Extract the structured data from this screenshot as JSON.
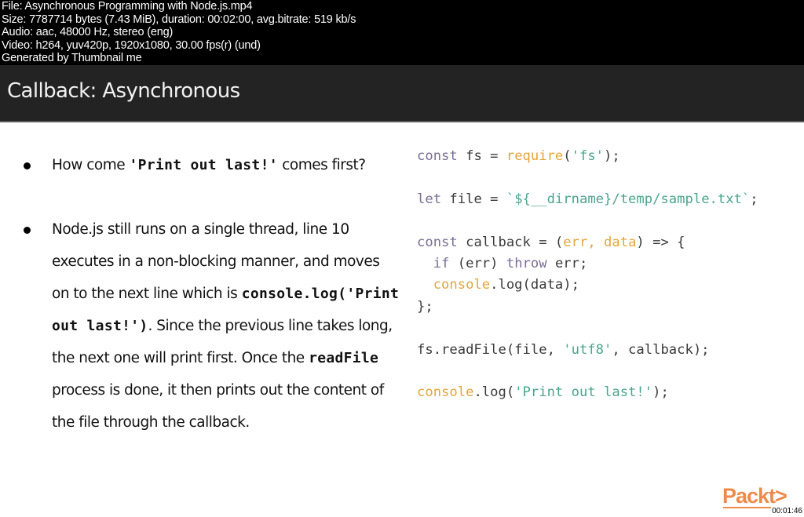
{
  "meta": {
    "lines": [
      "File: Asynchronous Programming with Node.js.mp4",
      "Size: 7787714 bytes (7.43 MiB), duration: 00:02:00, avg.bitrate: 519 kb/s",
      "Audio: aac, 48000 Hz, stereo (eng)",
      "Video: h264, yuv420p, 1920x1080, 30.00 fps(r) (und)",
      "Generated by Thumbnail me"
    ]
  },
  "slide": {
    "title": "Callback: Asynchronous",
    "bullets": [
      {
        "parts": [
          {
            "text": "How come ",
            "style": "normal"
          },
          {
            "text": "'Print out last!'",
            "style": "code"
          },
          {
            "text": " comes first?",
            "style": "normal"
          }
        ]
      },
      {
        "parts": [
          {
            "text": "Node.js still runs on a single thread, line 10 executes in a non-blocking manner, and moves on to the next line which is ",
            "style": "normal"
          },
          {
            "text": "console.log('Print out last!')",
            "style": "code"
          },
          {
            "text": ". Since the previous line takes long, the next one will print first. Once the ",
            "style": "normal"
          },
          {
            "text": "readFile",
            "style": "code"
          },
          {
            "text": " process is done, it then prints out the content of the file through the callback.",
            "style": "normal"
          }
        ]
      }
    ],
    "code_lines": [
      [
        {
          "t": "const",
          "c": "kw"
        },
        {
          "t": " fs = ",
          "c": ""
        },
        {
          "t": "require",
          "c": "fn"
        },
        {
          "t": "(",
          "c": ""
        },
        {
          "t": "'fs'",
          "c": "str"
        },
        {
          "t": ");",
          "c": ""
        }
      ],
      [],
      [
        {
          "t": "let",
          "c": "kw"
        },
        {
          "t": " file = ",
          "c": ""
        },
        {
          "t": "`${__dirname}/temp/sample.txt`",
          "c": "str"
        },
        {
          "t": ";",
          "c": ""
        }
      ],
      [],
      [
        {
          "t": "const",
          "c": "kw"
        },
        {
          "t": " callback = (",
          "c": ""
        },
        {
          "t": "err, data",
          "c": "fn"
        },
        {
          "t": ") => {",
          "c": ""
        }
      ],
      [
        {
          "t": "  ",
          "c": ""
        },
        {
          "t": "if",
          "c": "kw"
        },
        {
          "t": " (err) ",
          "c": ""
        },
        {
          "t": "throw",
          "c": "kw"
        },
        {
          "t": " err;",
          "c": ""
        }
      ],
      [
        {
          "t": "  ",
          "c": ""
        },
        {
          "t": "console",
          "c": "fn"
        },
        {
          "t": ".log(data);",
          "c": ""
        }
      ],
      [
        {
          "t": "};",
          "c": ""
        }
      ],
      [],
      [
        {
          "t": "fs.readFile(file, ",
          "c": ""
        },
        {
          "t": "'utf8'",
          "c": "str"
        },
        {
          "t": ", callback);",
          "c": ""
        }
      ],
      [],
      [
        {
          "t": "console",
          "c": "fn"
        },
        {
          "t": ".log(",
          "c": ""
        },
        {
          "t": "'Print out last!'",
          "c": "str"
        },
        {
          "t": ");",
          "c": ""
        }
      ]
    ]
  },
  "branding": {
    "logo": "Packt>",
    "timestamp": "00:01:46"
  },
  "colors": {
    "keyword": "#7a6e95",
    "function": "#e5a43a",
    "string": "#4ca58b",
    "logo": "#ee8a4a",
    "title_bar": "#232323"
  }
}
